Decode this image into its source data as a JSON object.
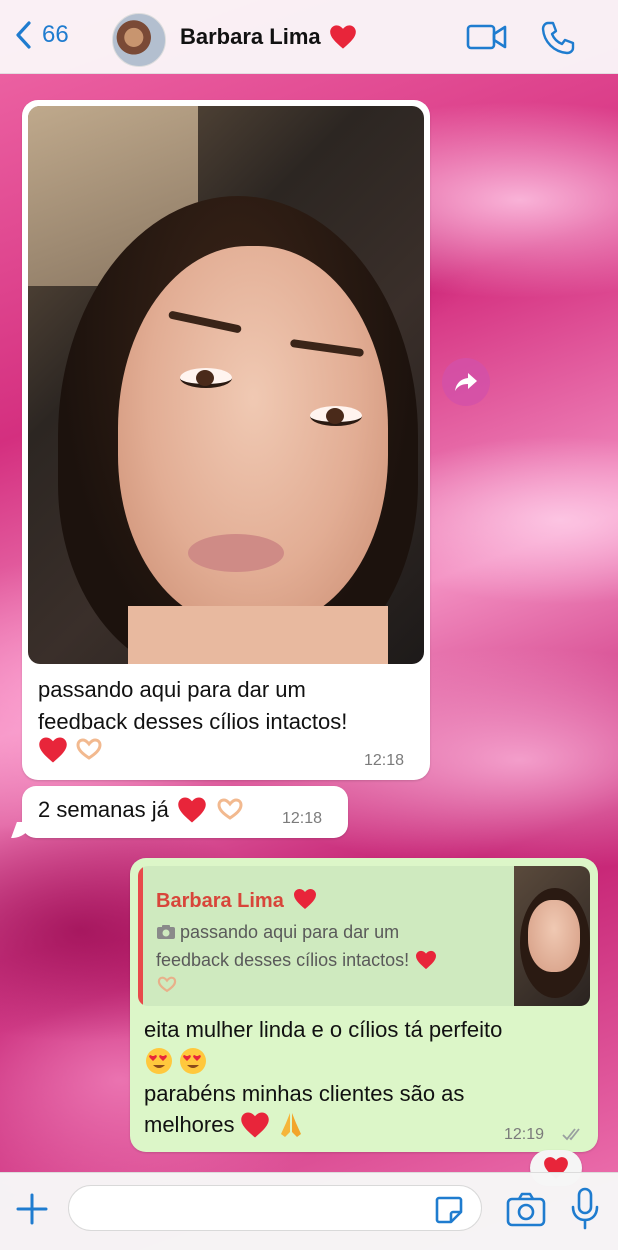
{
  "header": {
    "back_count": "66",
    "contact_name": "Barbara Lima"
  },
  "messages": [
    {
      "direction": "incoming",
      "type": "image",
      "caption_line1": "passando aqui para dar um",
      "caption_line2": "feedback desses cílios intactos!",
      "time": "12:18"
    },
    {
      "direction": "incoming",
      "type": "text",
      "text": "2 semanas já",
      "time": "12:18"
    },
    {
      "direction": "outgoing",
      "type": "reply",
      "quoted": {
        "author": "Barbara Lima",
        "text_line1": "passando aqui para dar um",
        "text_line2": "feedback desses cílios intactos!"
      },
      "line1": "eita mulher linda e o cílios tá perfeito",
      "line3": "parabéns minhas clientes são as",
      "line4": "melhores",
      "time": "12:19",
      "status": "read"
    }
  ],
  "composer": {
    "placeholder": ""
  },
  "colors": {
    "accent": "#1f7ccf",
    "outgoing_bubble": "#dcf6c8",
    "quote_author": "#d8453a",
    "heart": "#e8253a"
  },
  "icons": [
    "chevron-left-icon",
    "video-call-icon",
    "phone-icon",
    "forward-icon",
    "plus-icon",
    "sticker-icon",
    "camera-icon",
    "microphone-icon",
    "heart-icon",
    "heart-hands-icon",
    "heart-eyes-icon",
    "praying-hands-icon",
    "double-check-icon"
  ]
}
